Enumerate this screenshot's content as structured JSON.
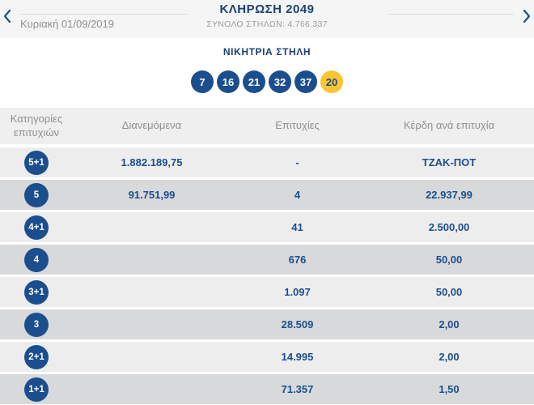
{
  "header": {
    "title": "ΚΛΗΡΩΣΗ 2049",
    "subtitle": "ΣΥΝΟΛΟ ΣΤΗΛΩΝ: 4.766.337",
    "date": "Κυριακή 01/09/2019",
    "prev_icon": "chevron-left",
    "next_icon": "chevron-right"
  },
  "winning": {
    "label": "ΝΙΚΗΤΡΙΑ ΣΤΗΛΗ",
    "numbers": [
      "7",
      "16",
      "21",
      "32",
      "37"
    ],
    "joker": "20"
  },
  "table": {
    "headers": [
      "Κατηγορίες επιτυχιών",
      "Διανεμόμενα",
      "Επιτυχίες",
      "Κέρδη ανά επιτυχία"
    ],
    "rows": [
      {
        "category": "5+1",
        "distributed": "1.882.189,75",
        "winners": "-",
        "prize": "ΤΖΑΚ-ΠΟΤ"
      },
      {
        "category": "5",
        "distributed": "91.751,99",
        "winners": "4",
        "prize": "22.937,99"
      },
      {
        "category": "4+1",
        "distributed": "",
        "winners": "41",
        "prize": "2.500,00"
      },
      {
        "category": "4",
        "distributed": "",
        "winners": "676",
        "prize": "50,00"
      },
      {
        "category": "3+1",
        "distributed": "",
        "winners": "1.097",
        "prize": "50,00"
      },
      {
        "category": "3",
        "distributed": "",
        "winners": "28.509",
        "prize": "2,00"
      },
      {
        "category": "2+1",
        "distributed": "",
        "winners": "14.995",
        "prize": "2,00"
      },
      {
        "category": "1+1",
        "distributed": "",
        "winners": "71.357",
        "prize": "1,50"
      }
    ]
  },
  "colors": {
    "navy": "#1b4e8e",
    "title_navy": "#1c4173",
    "joker_yellow": "#fac433",
    "row_light": "#ededee",
    "row_dark": "#d8d9da",
    "topbar_bg": "#f5f5f6",
    "muted_text": "#8d8f91"
  }
}
